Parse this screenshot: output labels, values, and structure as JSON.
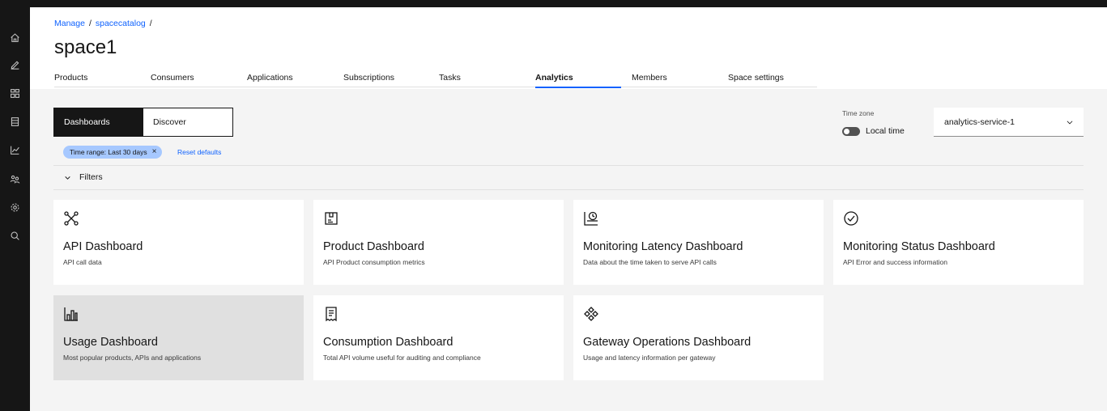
{
  "breadcrumb": [
    "Manage",
    "spacecatalog"
  ],
  "page_title": "space1",
  "tabs": [
    {
      "label": "Products",
      "active": false
    },
    {
      "label": "Consumers",
      "active": false
    },
    {
      "label": "Applications",
      "active": false
    },
    {
      "label": "Subscriptions",
      "active": false
    },
    {
      "label": "Tasks",
      "active": false
    },
    {
      "label": "Analytics",
      "active": true
    },
    {
      "label": "Members",
      "active": false
    },
    {
      "label": "Space settings",
      "active": false
    }
  ],
  "switcher": {
    "dashboards": "Dashboards",
    "discover": "Discover",
    "selected": "Dashboards"
  },
  "timezone": {
    "label": "Time zone",
    "toggle_label": "Local time",
    "toggle_on": false
  },
  "service_select": {
    "value": "analytics-service-1"
  },
  "filter_tag": {
    "label": "Time range: Last 30 days"
  },
  "reset_label": "Reset defaults",
  "filters_label": "Filters",
  "sidebar_icons": [
    "home-icon",
    "edit-icon",
    "grid-icon",
    "document-icon",
    "chart-icon",
    "users-icon",
    "settings-icon",
    "search-icon"
  ],
  "dashboards": [
    {
      "icon": "network-icon",
      "title": "API Dashboard",
      "desc": "API call data"
    },
    {
      "icon": "product-icon",
      "title": "Product Dashboard",
      "desc": "API Product consumption metrics"
    },
    {
      "icon": "latency-icon",
      "title": "Monitoring Latency Dashboard",
      "desc": "Data about the time taken to serve API calls"
    },
    {
      "icon": "checkmark-icon",
      "title": "Monitoring Status Dashboard",
      "desc": "API Error and success information"
    },
    {
      "icon": "bar-chart-icon",
      "title": "Usage Dashboard",
      "desc": "Most popular products, APIs and applications",
      "highlighted": true
    },
    {
      "icon": "receipt-icon",
      "title": "Consumption Dashboard",
      "desc": "Total API volume useful for auditing and compliance"
    },
    {
      "icon": "gateway-icon",
      "title": "Gateway Operations Dashboard",
      "desc": "Usage and latency information per gateway"
    }
  ]
}
